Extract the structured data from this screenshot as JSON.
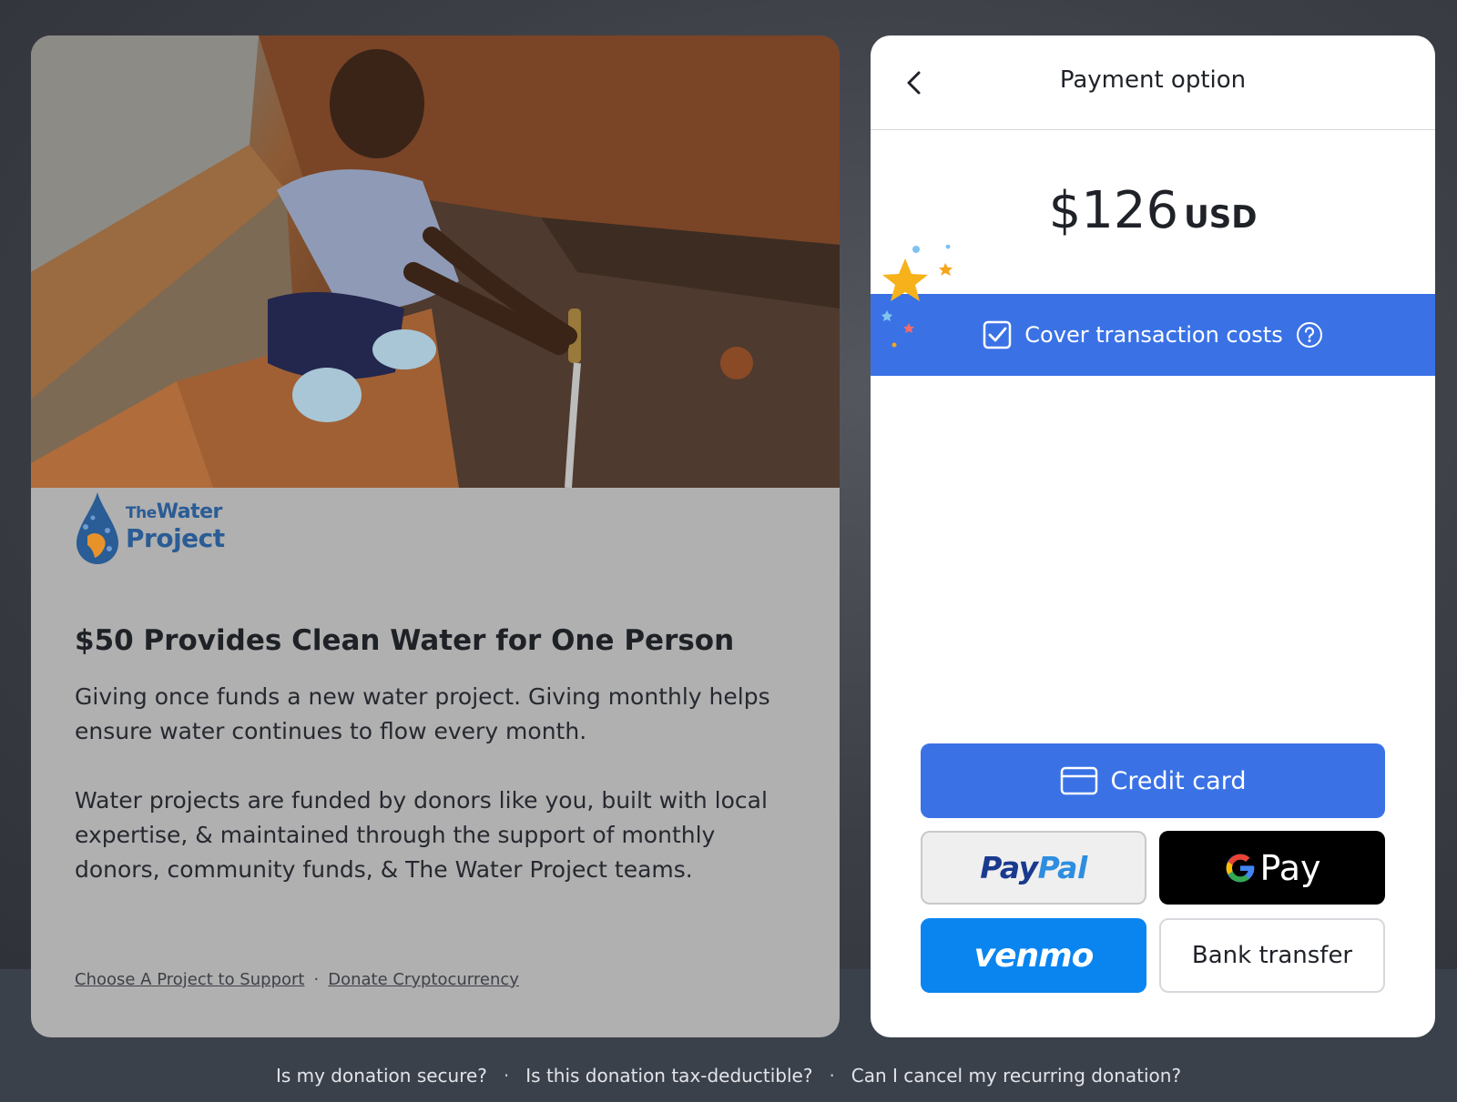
{
  "left_card": {
    "photo_alt": "child-at-water-tap",
    "logo": {
      "line1_small": "The",
      "line1": "Water",
      "line2": "Project"
    },
    "title": "$50 Provides Clean Water for One Person",
    "paragraph1": "Giving once funds a new water project. Giving monthly helps ensure water continues to flow every month.",
    "paragraph2": "Water projects are funded by donors like you, built with local expertise, & maintained through the support of monthly donors, community funds, & The Water Project teams.",
    "links": [
      "Choose A Project to Support",
      "Donate Cryptocurrency"
    ],
    "link_separator": "·"
  },
  "payment": {
    "title": "Payment option",
    "back_icon": "chevron-left-icon",
    "amount": "$126",
    "currency": "USD",
    "cover_costs": {
      "label": "Cover transaction costs",
      "checked": true,
      "help_icon": "question-circle-icon"
    },
    "buttons": {
      "credit_card": "Credit card",
      "paypal_part1": "Pay",
      "paypal_part2": "Pal",
      "gpay": "Pay",
      "venmo": "venmo",
      "bank_transfer": "Bank transfer"
    },
    "colors": {
      "primary": "#3a72e6",
      "venmo": "#0a85f0",
      "gpay": "#000000"
    }
  },
  "footer": {
    "links": [
      "Is my donation secure?",
      "Is this donation tax-deductible?",
      "Can I cancel my recurring donation?"
    ],
    "separator": "·"
  }
}
